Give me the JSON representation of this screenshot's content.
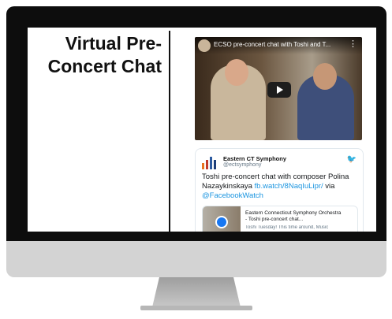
{
  "slide": {
    "title_line1": "Virtual Pre-",
    "title_line2": "Concert Chat"
  },
  "video": {
    "title": "ECSO pre-concert chat with Toshi and T...",
    "more_icon": "⋮"
  },
  "tweet": {
    "account_name": "Eastern CT Symphony",
    "handle": "@ectsymphony",
    "text_prefix": "Toshi pre-concert chat with composer Polina Nazaykinskaya ",
    "link": "fb.watch/8NaqIuLipr/",
    "text_mid": " via ",
    "mention": "@FacebookWatch",
    "card_title_line1": "Eastern Connecticut Symphony Orchestra",
    "card_title_line2": "- Toshi pre-concert chat...",
    "card_desc": "Toshi Tuesday! This time around, Music"
  },
  "colors": {
    "link": "#1b95e0",
    "twitter_blue": "#1da1f2",
    "facebook_blue": "#1877f2"
  }
}
